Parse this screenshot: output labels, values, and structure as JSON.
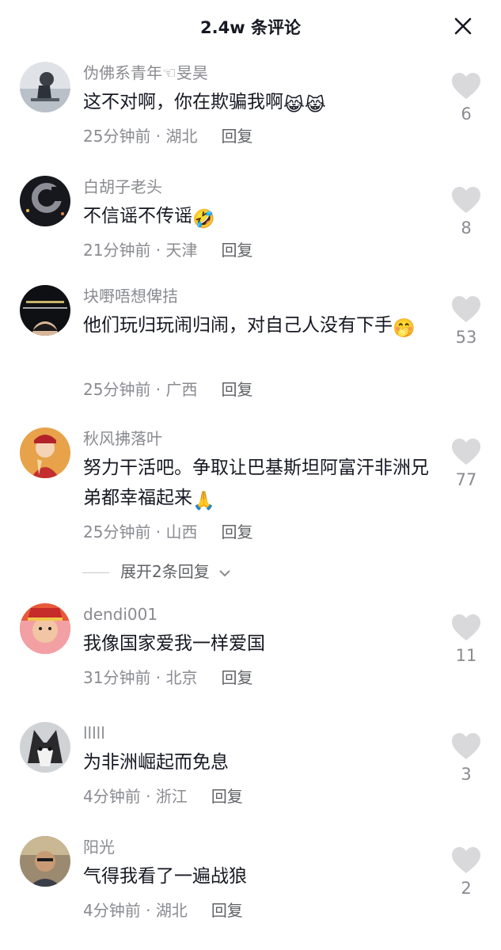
{
  "header": {
    "title": "2.4w 条评论"
  },
  "comments": [
    {
      "username": "伪佛系青年☜旻昊",
      "text": "这不对啊，你在欺骗我啊",
      "emoji": "😹😹",
      "time": "25分钟前",
      "location": "湖北",
      "reply": "回复",
      "likes": "6"
    },
    {
      "username": "白胡子老头",
      "text": "不信谣不传谣",
      "emoji": "🤣",
      "time": "21分钟前",
      "location": "天津",
      "reply": "回复",
      "likes": "8"
    },
    {
      "username": "块嘢唔想俾拮",
      "text": "他们玩归玩闹归闹，对自己人没有下手",
      "emoji": "🤭",
      "time": "25分钟前",
      "location": "广西",
      "reply": "回复",
      "likes": "53"
    },
    {
      "username": "秋风拂落叶",
      "text": "努力干活吧。争取让巴基斯坦阿富汗非洲兄弟都幸福起来",
      "emoji": "🙏",
      "time": "25分钟前",
      "location": "山西",
      "reply": "回复",
      "likes": "77"
    },
    {
      "username": "dendi001",
      "text": "我像国家爱我一样爱国",
      "emoji": "",
      "time": "31分钟前",
      "location": "北京",
      "reply": "回复",
      "likes": "11"
    },
    {
      "username": "lllll",
      "text": "为非洲崛起而免息",
      "emoji": "",
      "time": "4分钟前",
      "location": "浙江",
      "reply": "回复",
      "likes": "3"
    },
    {
      "username": "阳光",
      "text": "气得我看了一遍战狼",
      "emoji": "",
      "time": "4分钟前",
      "location": "湖北",
      "reply": "回复",
      "likes": "2"
    }
  ],
  "expand_replies": "展开2条回复",
  "icons": {
    "close": "close-icon",
    "like": "heart-icon",
    "expand": "chevron-down-icon"
  },
  "colors": {
    "text": "#161823",
    "meta": "#8a8b91",
    "heart": "#d9d9dc"
  }
}
